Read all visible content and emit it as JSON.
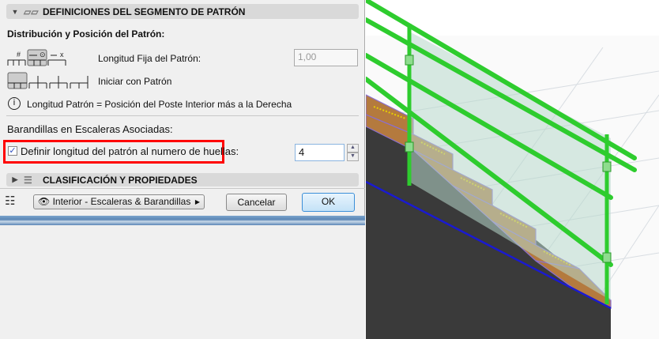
{
  "pattern_section": {
    "title": "DEFINICIONES DEL SEGMENTO DE PATRÓN",
    "distribution_label": "Distribución y Posición del Patrón:",
    "fixed_length_label": "Longitud Fija del Patrón:",
    "fixed_length_value": "1,00",
    "start_label": "Iniciar con Patrón",
    "info_text": "Longitud Patrón = Posición del Poste Interior más a la Derecha",
    "stairs_label": "Barandillas en Escaleras Asociadas:",
    "checkbox_label": "Definir longitud del patrón al numero de huellas:",
    "checkbox_checked": true,
    "treads_value": "4"
  },
  "classification_section": {
    "title": "CLASIFICACIÓN Y PROPIEDADES"
  },
  "footer": {
    "layer_combo": "Interior - Escaleras & Barandillas",
    "cancel": "Cancelar",
    "ok": "OK"
  },
  "colors": {
    "highlight": "#ff0000",
    "railing": "#2ecc2e",
    "stringer": "#1a1ad0"
  }
}
